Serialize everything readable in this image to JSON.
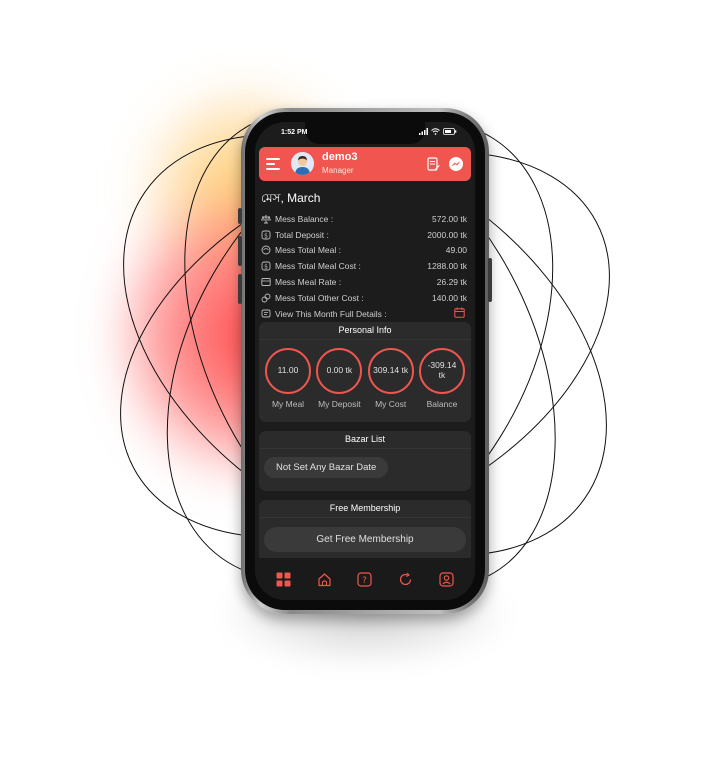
{
  "status_bar": {
    "time": "1:52 PM"
  },
  "header": {
    "user_name": "demo3",
    "user_role": "Manager",
    "icons": [
      "menu-icon",
      "avatar",
      "note-icon",
      "messenger-icon"
    ]
  },
  "mess_title": "মেস, March",
  "summary": [
    {
      "icon": "scale-icon",
      "label": "Mess Balance :",
      "value": "572.00 tk"
    },
    {
      "icon": "deposit-icon",
      "label": "Total Deposit :",
      "value": "2000.00 tk"
    },
    {
      "icon": "meal-icon",
      "label": "Mess Total Meal :",
      "value": "49.00"
    },
    {
      "icon": "cost-icon",
      "label": "Mess Total Meal Cost :",
      "value": "1288.00 tk"
    },
    {
      "icon": "rate-icon",
      "label": "Mess Meal Rate :",
      "value": "26.29 tk"
    },
    {
      "icon": "other-cost-icon",
      "label": "Mess Total Other Cost :",
      "value": "140.00 tk"
    },
    {
      "icon": "details-icon",
      "label": "View This Month Full Details :",
      "value": ""
    }
  ],
  "personal_info": {
    "title": "Personal Info",
    "items": [
      {
        "value": "11.00",
        "label": "My Meal"
      },
      {
        "value": "0.00 tk",
        "label": "My Deposit"
      },
      {
        "value": "309.14 tk",
        "label": "My Cost"
      },
      {
        "value": "-309.14 tk",
        "label": "Balance"
      }
    ]
  },
  "bazar_list": {
    "title": "Bazar List",
    "button": "Not Set Any Bazar Date"
  },
  "free_membership": {
    "title": "Free Membership",
    "button": "Get Free Membership"
  },
  "bottom_nav": [
    "dashboard-icon",
    "home-icon",
    "help-icon",
    "refresh-icon",
    "profile-icon"
  ],
  "colors": {
    "accent": "#f0564f",
    "screen_bg": "#1c1c1c",
    "card_bg": "#2b2b2b"
  }
}
